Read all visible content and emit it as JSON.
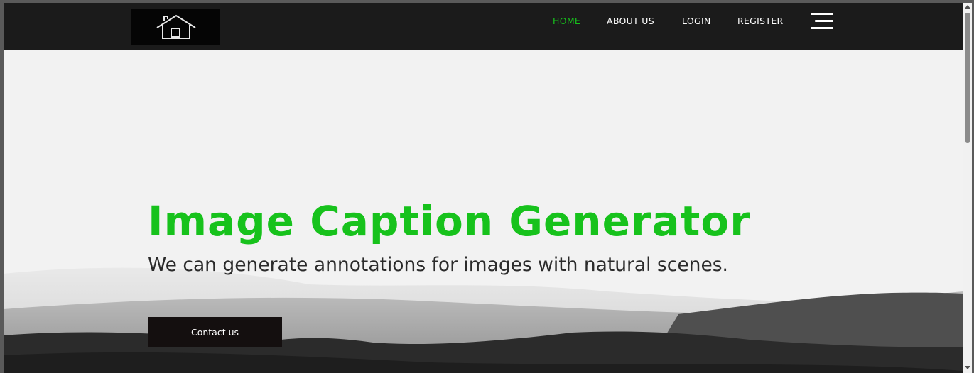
{
  "header": {
    "logo_icon": "home-icon",
    "nav": [
      {
        "label": "HOME",
        "active": true
      },
      {
        "label": "ABOUT US",
        "active": false
      },
      {
        "label": "LOGIN",
        "active": false
      },
      {
        "label": "REGISTER",
        "active": false
      }
    ],
    "menu_icon": "hamburger-menu-icon"
  },
  "hero": {
    "title": "Image Caption Generator",
    "subtitle": "We can generate annotations for images with natural scenes.",
    "cta_label": "Contact us"
  },
  "colors": {
    "accent": "#17c21c",
    "navbar_bg": "#1b1b1b",
    "button_bg": "#140f0f",
    "hero_bg": "#f2f2f2"
  }
}
